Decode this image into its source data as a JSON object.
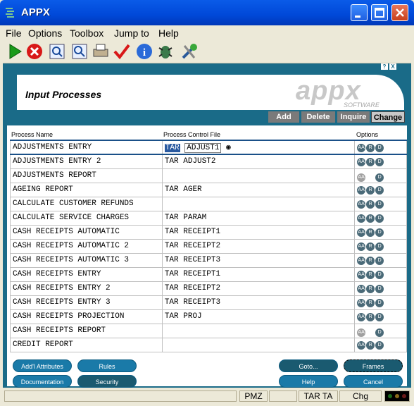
{
  "window": {
    "title": "APPX"
  },
  "menu": [
    "File",
    "Options",
    "Toolbox",
    "Jump to",
    "Help"
  ],
  "toolbar_icons": [
    "run-icon",
    "stop-icon",
    "find-icon",
    "find-next-icon",
    "print-icon",
    "check-icon",
    "info-icon",
    "bug-icon",
    "tools-icon"
  ],
  "panel": {
    "title": "Input Processes",
    "logo": "appx",
    "logo_sub": "SOFTWARE",
    "help_btn": "?",
    "close_btn": "X",
    "modes": [
      "Add",
      "Delete",
      "Inquire",
      "Change"
    ],
    "active_mode": "Change"
  },
  "columns": {
    "name": "Process Name",
    "pcf": "Process Control File",
    "options": "Options"
  },
  "rows": [
    {
      "name": "ADJUSTMENTS ENTRY",
      "app": "TAR",
      "file": "ADJUST1",
      "a": true,
      "r": true,
      "d": true
    },
    {
      "name": "ADJUSTMENTS ENTRY 2",
      "app": "TAR",
      "file": "ADJUST2",
      "a": true,
      "r": true,
      "d": true
    },
    {
      "name": "ADJUSTMENTS REPORT",
      "app": "",
      "file": "",
      "a": false,
      "r": false,
      "d": true
    },
    {
      "name": "AGEING REPORT",
      "app": "TAR",
      "file": "AGER",
      "a": true,
      "r": true,
      "d": true
    },
    {
      "name": "CALCULATE CUSTOMER REFUNDS",
      "app": "",
      "file": "",
      "a": true,
      "r": true,
      "d": true
    },
    {
      "name": "CALCULATE SERVICE CHARGES",
      "app": "TAR",
      "file": "PARAM",
      "a": true,
      "r": true,
      "d": true
    },
    {
      "name": "CASH RECEIPTS AUTOMATIC",
      "app": "TAR",
      "file": "RECEIPT1",
      "a": true,
      "r": true,
      "d": true
    },
    {
      "name": "CASH RECEIPTS AUTOMATIC 2",
      "app": "TAR",
      "file": "RECEIPT2",
      "a": true,
      "r": true,
      "d": true
    },
    {
      "name": "CASH RECEIPTS AUTOMATIC 3",
      "app": "TAR",
      "file": "RECEIPT3",
      "a": true,
      "r": true,
      "d": true
    },
    {
      "name": "CASH RECEIPTS ENTRY",
      "app": "TAR",
      "file": "RECEIPT1",
      "a": true,
      "r": true,
      "d": true
    },
    {
      "name": "CASH RECEIPTS ENTRY 2",
      "app": "TAR",
      "file": "RECEIPT2",
      "a": true,
      "r": true,
      "d": true
    },
    {
      "name": "CASH RECEIPTS ENTRY 3",
      "app": "TAR",
      "file": "RECEIPT3",
      "a": true,
      "r": true,
      "d": true
    },
    {
      "name": "CASH RECEIPTS PROJECTION",
      "app": "TAR",
      "file": "PROJ",
      "a": true,
      "r": true,
      "d": true
    },
    {
      "name": "CASH RECEIPTS REPORT",
      "app": "",
      "file": "",
      "a": false,
      "r": false,
      "d": true
    },
    {
      "name": "CREDIT REPORT",
      "app": "",
      "file": "",
      "a": true,
      "r": true,
      "d": true
    }
  ],
  "option_labels": {
    "a": "AA",
    "r": "R",
    "d": "D"
  },
  "buttons": {
    "addl": "Add'l Attributes",
    "rules": "Rules",
    "documentation": "Documentation",
    "security": "Security",
    "goto": "Goto...",
    "frames": "Frames",
    "help": "Help",
    "cancel": "Cancel"
  },
  "status": {
    "c1": "",
    "c2": "PMZ",
    "c3": "",
    "c4": "TAR TA",
    "c5": "Chg"
  }
}
